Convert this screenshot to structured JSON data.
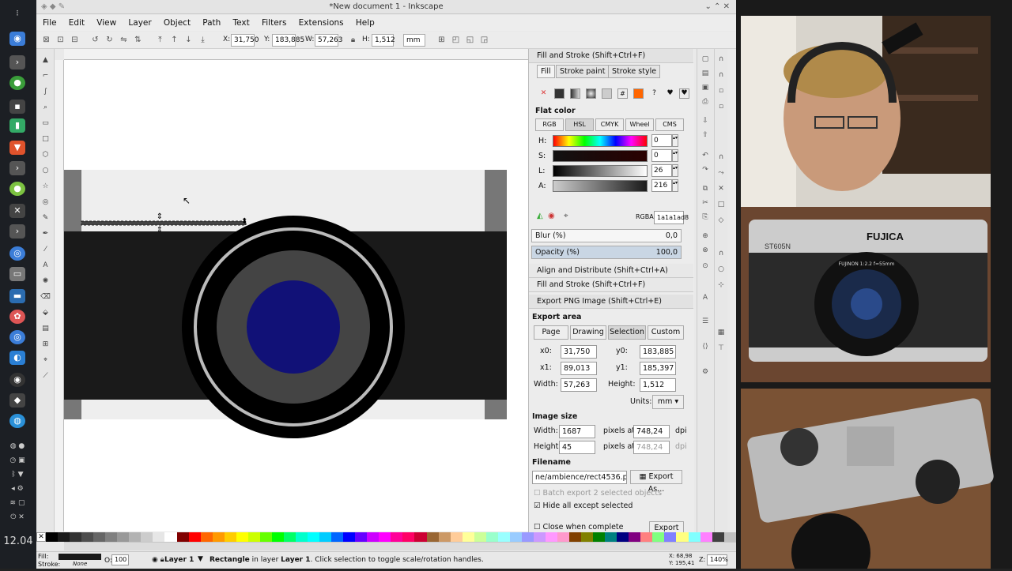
{
  "clock": "12.04",
  "window_title": "*New document 1 - Inkscape",
  "menus": [
    "File",
    "Edit",
    "View",
    "Layer",
    "Object",
    "Path",
    "Text",
    "Filters",
    "Extensions",
    "Help"
  ],
  "toolbar": {
    "x_label": "X:",
    "x": "31,750",
    "y_label": "Y:",
    "y": "183,885",
    "w_label": "W:",
    "w": "57,263",
    "h_label": "H:",
    "h": "1,512",
    "unit": "mm"
  },
  "fill_stroke": {
    "title": "Fill and Stroke (Shift+Ctrl+F)",
    "tabs": [
      "Fill",
      "Stroke paint",
      "Stroke style"
    ],
    "flat_color": "Flat color",
    "modes": [
      "RGB",
      "HSL",
      "CMYK",
      "Wheel",
      "CMS"
    ],
    "channels": [
      {
        "label": "H:",
        "value": "0"
      },
      {
        "label": "S:",
        "value": "0"
      },
      {
        "label": "L:",
        "value": "26"
      },
      {
        "label": "A:",
        "value": "216"
      }
    ],
    "rgba_label": "RGBA:",
    "rgba": "1a1a1ad8",
    "blur_label": "Blur (%)",
    "blur": "0,0",
    "opacity_label": "Opacity (%)",
    "opacity": "100,0",
    "fill_color": "#1a1a1a"
  },
  "collapsed": [
    "Align and Distribute (Shift+Ctrl+A)",
    "Fill and Stroke (Shift+Ctrl+F)"
  ],
  "export": {
    "title": "Export PNG Image (Shift+Ctrl+E)",
    "area_label": "Export area",
    "area_buttons": [
      "Page",
      "Drawing",
      "Selection",
      "Custom"
    ],
    "x0_label": "x0:",
    "x0": "31,750",
    "y0_label": "y0:",
    "y0": "183,885",
    "x1_label": "x1:",
    "x1": "89,013",
    "y1_label": "y1:",
    "y1": "185,397",
    "width_label": "Width:",
    "width": "57,263",
    "height_label": "Height:",
    "height": "1,512",
    "units_label": "Units:",
    "units": "mm",
    "image_size_label": "Image size",
    "img_width_label": "Width:",
    "img_width": "1687",
    "img_height_label": "Height:",
    "img_height": "45",
    "pixels_at": "pixels at",
    "dpi_x": "748,24",
    "dpi_y": "748,24",
    "dpi": "dpi",
    "filename_label": "Filename",
    "filename": "ne/ambience/rect4536.png",
    "export_as": "Export As...",
    "batch": "Batch export 2 selected objects",
    "hide": "Hide all except selected",
    "close_when": "Close when complete",
    "export_btn": "Export"
  },
  "status": {
    "fill_label": "Fill:",
    "stroke_label": "Stroke:",
    "stroke_value": "None",
    "opacity_label": "O:",
    "opacity": "100",
    "layer": "Layer 1",
    "message_bold": "Rectangle",
    "message_mid": " in layer ",
    "message_layer": "Layer 1",
    "message_end": ". Click selection to toggle scale/rotation handles.",
    "coord_x_label": "X:",
    "coord_x": "68,98",
    "coord_y_label": "Y:",
    "coord_y": "195,41",
    "zoom_label": "Z:",
    "zoom": "140%"
  },
  "palette_colors": [
    "#000000",
    "#1a1a1a",
    "#333333",
    "#4d4d4d",
    "#666666",
    "#808080",
    "#999999",
    "#b3b3b3",
    "#cccccc",
    "#e6e6e6",
    "#ffffff",
    "#800000",
    "#ff0000",
    "#ff6600",
    "#ff9900",
    "#ffcc00",
    "#ffff00",
    "#ccff00",
    "#66ff00",
    "#00ff00",
    "#00ff66",
    "#00ffcc",
    "#00ffff",
    "#00ccff",
    "#0066ff",
    "#0000ff",
    "#6600ff",
    "#cc00ff",
    "#ff00ff",
    "#ff0099",
    "#ff0066",
    "#cc0033",
    "#996633",
    "#cc9966",
    "#ffcc99",
    "#ffff99",
    "#ccff99",
    "#99ffcc",
    "#99ffff",
    "#99ccff",
    "#9999ff",
    "#cc99ff",
    "#ff99ff",
    "#ff99cc",
    "#804000",
    "#808000",
    "#008000",
    "#008080",
    "#000080",
    "#800080",
    "#ff8080",
    "#80ff80",
    "#8080ff",
    "#ffff80",
    "#80ffff",
    "#ff80ff",
    "#404040",
    "#c0c0c0"
  ],
  "webcam": {
    "camera1_brand": "FUJICA",
    "camera1_model": "ST605N",
    "lens1": "FUJINON 1:2.2 f=55mm"
  }
}
